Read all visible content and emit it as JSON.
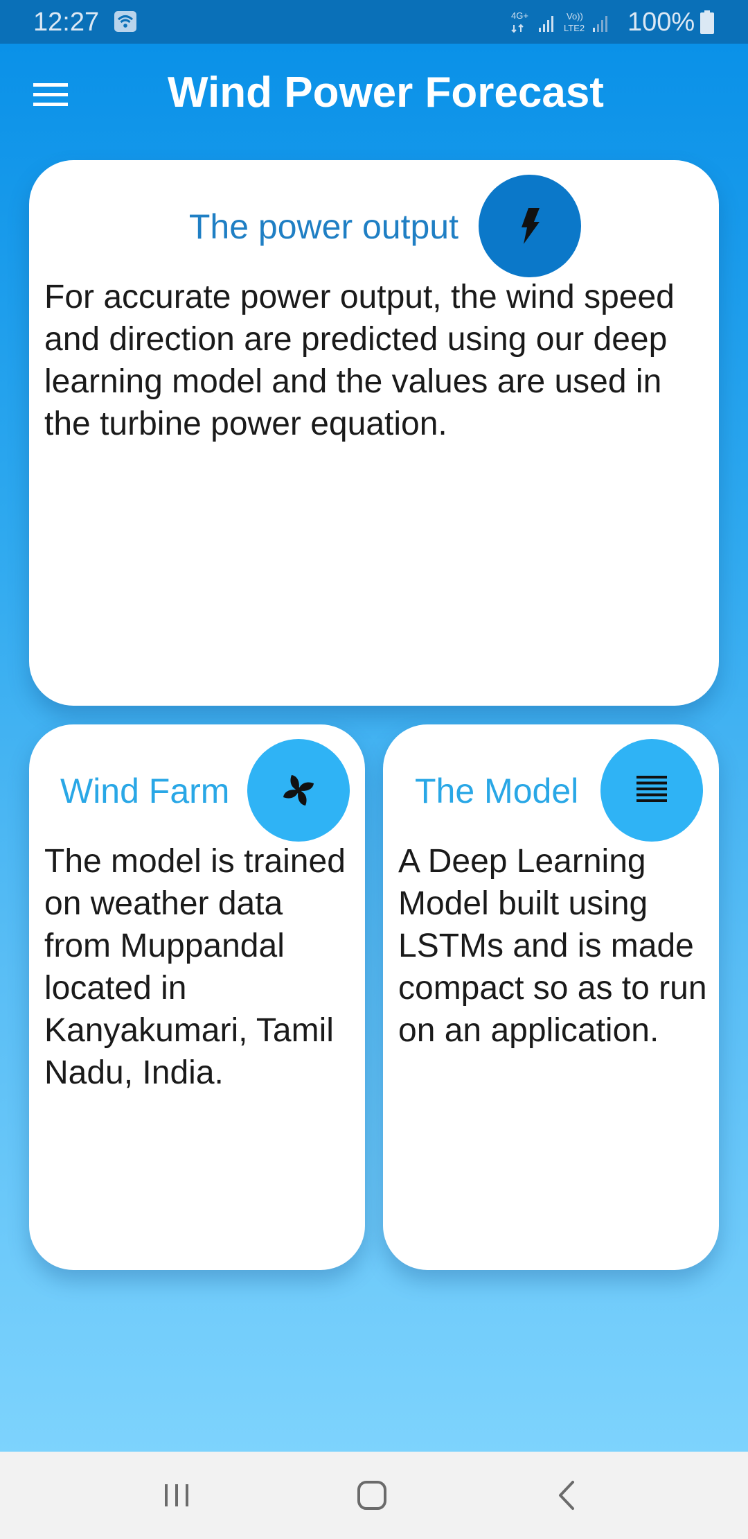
{
  "status_bar": {
    "time": "12:27",
    "network_labels": {
      "primary": "4G+",
      "secondary_top": "Vo))",
      "secondary_bottom": "LTE2"
    },
    "battery": "100%",
    "icons": [
      "wifi-icon",
      "signal-icon",
      "battery-icon"
    ]
  },
  "app_bar": {
    "title": "Wind Power Forecast",
    "menu_icon": "hamburger-menu-icon"
  },
  "cards": {
    "power": {
      "title": "The power output",
      "icon": "lightning-bolt-icon",
      "body": "For accurate power output, the wind speed and direction are predicted using our deep learning model and the values are used in the turbine power equation."
    },
    "farm": {
      "title": "Wind Farm",
      "icon": "fan-icon",
      "body": "The model is trained on weather data from Muppandal located in Kanyakumari, Tamil Nadu, India."
    },
    "model": {
      "title": "The Model",
      "icon": "justify-lines-icon",
      "body": "A Deep Learning Model built using LSTMs and is made compact so as to run on an application."
    }
  },
  "nav_bar": {
    "buttons": [
      "recents-button",
      "home-button",
      "back-button"
    ]
  },
  "colors": {
    "status_bar": "#0a70b8",
    "gradient_top": "#0a91e8",
    "gradient_bottom": "#7dd3fd",
    "power_icon_bg": "#0b78c9",
    "card_icon_bg": "#2fb3f5",
    "power_title": "#1f7fc4",
    "card_title": "#29a7e6"
  }
}
